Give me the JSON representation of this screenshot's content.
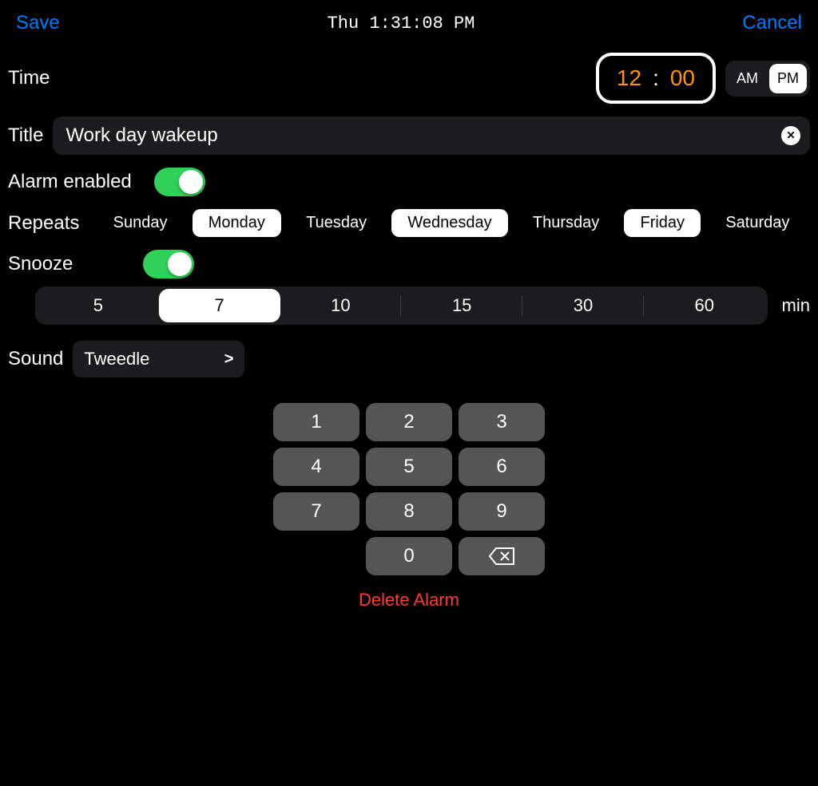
{
  "header": {
    "save": "Save",
    "clock": "Thu 1:31:08 PM",
    "cancel": "Cancel"
  },
  "time": {
    "label": "Time",
    "hour": "12",
    "separator": ":",
    "minute": "00",
    "am": "AM",
    "pm": "PM",
    "selected_period": "PM"
  },
  "title": {
    "label": "Title",
    "value": "Work day wakeup"
  },
  "alarm_enabled": {
    "label": "Alarm enabled",
    "on": true
  },
  "repeats": {
    "label": "Repeats",
    "days": [
      {
        "name": "Sunday",
        "active": false
      },
      {
        "name": "Monday",
        "active": true
      },
      {
        "name": "Tuesday",
        "active": false
      },
      {
        "name": "Wednesday",
        "active": true
      },
      {
        "name": "Thursday",
        "active": false
      },
      {
        "name": "Friday",
        "active": true
      },
      {
        "name": "Saturday",
        "active": false
      }
    ]
  },
  "snooze": {
    "label": "Snooze",
    "on": true,
    "unit": "min",
    "options": [
      {
        "label": "5",
        "active": false
      },
      {
        "label": "7",
        "active": true
      },
      {
        "label": "10",
        "active": false
      },
      {
        "label": "15",
        "active": false
      },
      {
        "label": "30",
        "active": false
      },
      {
        "label": "60",
        "active": false
      }
    ]
  },
  "sound": {
    "label": "Sound",
    "value": "Tweedle",
    "chevron": ">"
  },
  "keypad": {
    "r1": [
      "1",
      "2",
      "3"
    ],
    "r2": [
      "4",
      "5",
      "6"
    ],
    "r3": [
      "7",
      "8",
      "9"
    ],
    "r4": [
      "0"
    ]
  },
  "delete": "Delete Alarm",
  "clear_glyph": "✕"
}
